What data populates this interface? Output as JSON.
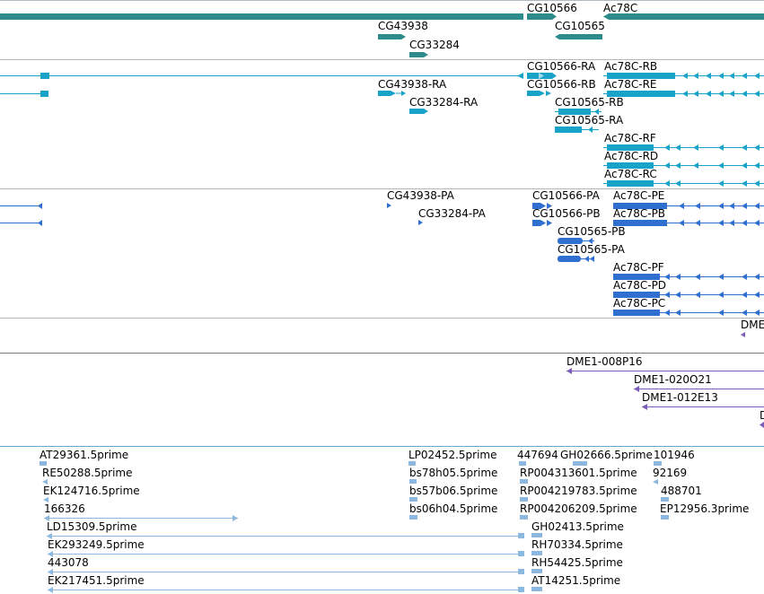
{
  "colors": {
    "gene": "#2e8b8b",
    "transcript": "#1aa3c8",
    "protein": "#2e6fd0",
    "clone": "#7b5cb8",
    "est": "#8cb8e0",
    "divider": "#b0b8c0",
    "divider_light": "#c8e0ee"
  },
  "genes": [
    {
      "name": "CG10566",
      "label": "CG10566"
    },
    {
      "name": "Ac78C",
      "label": "Ac78C"
    },
    {
      "name": "CG43938",
      "label": "CG43938"
    },
    {
      "name": "CG10565",
      "label": "CG10565"
    },
    {
      "name": "CG33284",
      "label": "CG33284"
    }
  ],
  "transcripts": [
    "CG10566-RA",
    "Ac78C-RB",
    "CG43938-RA",
    "CG10566-RB",
    "Ac78C-RE",
    "CG33284-RA",
    "CG10565-RB",
    "CG10565-RA",
    "Ac78C-RF",
    "Ac78C-RD",
    "Ac78C-RC"
  ],
  "proteins": [
    "CG43938-PA",
    "CG10566-PA",
    "Ac78C-PE",
    "CG33284-PA",
    "CG10566-PB",
    "Ac78C-PB",
    "CG10565-PB",
    "CG10565-PA",
    "Ac78C-PF",
    "Ac78C-PD",
    "Ac78C-PC"
  ],
  "track4_labels": [
    "DME"
  ],
  "clones": [
    "DME1-008P16",
    "DME1-020O21",
    "DME1-012E13",
    "D"
  ],
  "ests": [
    "AT29361.5prime",
    "LP02452.5prime",
    "447694",
    "GH02666.5prime",
    "101946",
    "RE50288.5prime",
    "bs78h05.5prime",
    "RP004313601.5prime",
    "92169",
    "EK124716.5prime",
    "bs57b06.5prime",
    "RP004219783.5prime",
    "488701",
    "166326",
    "bs06h04.5prime",
    "RP004206209.5prime",
    "EP12956.3prime",
    "LD15309.5prime",
    "GH02413.5prime",
    "EK293249.5prime",
    "RH70334.5prime",
    "443078",
    "RH54425.5prime",
    "EK217451.5prime",
    "AT14251.5prime"
  ]
}
